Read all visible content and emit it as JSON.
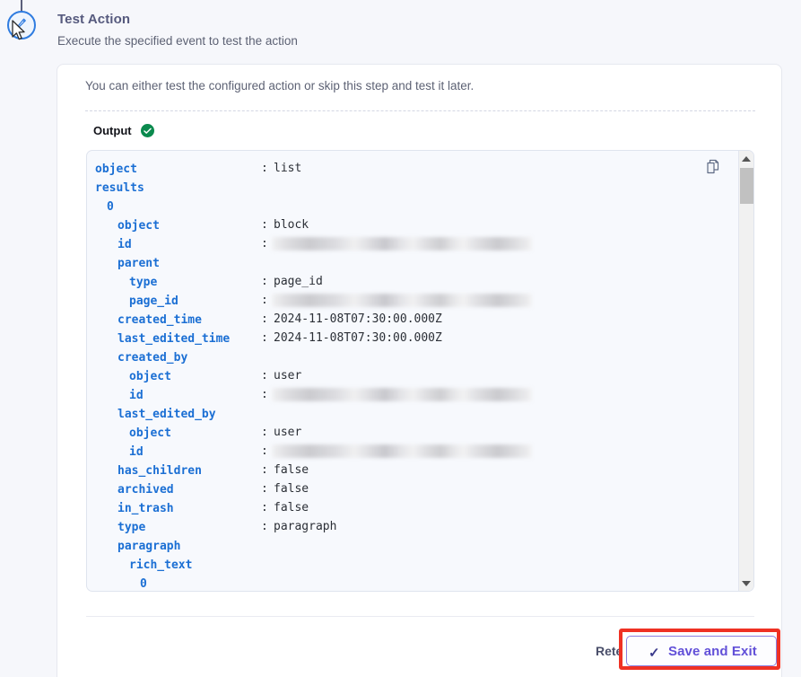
{
  "colors": {
    "accent_purple": "#6250d8",
    "highlight_red": "#ef3124",
    "success_green": "#0b8a4e",
    "json_key_blue": "#1b6fd4",
    "step_blue": "#2f7ce0"
  },
  "header": {
    "title": "Test Action",
    "subtitle": "Execute the specified event to test the action",
    "step_icon": "flask-icon",
    "cursor_icon": "mouse-pointer-icon"
  },
  "card": {
    "intro": "You can either test the configured action or skip this step and test it later.",
    "output_label": "Output",
    "output_status_icon": "check-circle-icon",
    "copy_icon": "copy-icon"
  },
  "scrollbar": {
    "up_icon": "triangle-up-icon",
    "down_icon": "triangle-down-icon"
  },
  "footer": {
    "retest_label": "Retest",
    "save_label": "Save and Exit",
    "save_icon": "check-icon"
  },
  "json_tree": [
    {
      "key": "object",
      "indent": 0,
      "value": "list",
      "redacted": false
    },
    {
      "key": "results",
      "indent": 0,
      "value": "",
      "redacted": false,
      "no_colon": true
    },
    {
      "key": "0",
      "indent": 1,
      "value": "",
      "redacted": false,
      "no_colon": true
    },
    {
      "key": "object",
      "indent": 2,
      "value": "block",
      "redacted": false
    },
    {
      "key": "id",
      "indent": 2,
      "value": "",
      "redacted": true
    },
    {
      "key": "parent",
      "indent": 2,
      "value": "",
      "redacted": false,
      "no_colon": true
    },
    {
      "key": "type",
      "indent": 3,
      "value": "page_id",
      "redacted": false
    },
    {
      "key": "page_id",
      "indent": 3,
      "value": "",
      "redacted": true
    },
    {
      "key": "created_time",
      "indent": 2,
      "value": "2024-11-08T07:30:00.000Z",
      "redacted": false
    },
    {
      "key": "last_edited_time",
      "indent": 2,
      "value": "2024-11-08T07:30:00.000Z",
      "redacted": false
    },
    {
      "key": "created_by",
      "indent": 2,
      "value": "",
      "redacted": false,
      "no_colon": true
    },
    {
      "key": "object",
      "indent": 3,
      "value": "user",
      "redacted": false
    },
    {
      "key": "id",
      "indent": 3,
      "value": "",
      "redacted": true
    },
    {
      "key": "last_edited_by",
      "indent": 2,
      "value": "",
      "redacted": false,
      "no_colon": true
    },
    {
      "key": "object",
      "indent": 3,
      "value": "user",
      "redacted": false
    },
    {
      "key": "id",
      "indent": 3,
      "value": "",
      "redacted": true
    },
    {
      "key": "has_children",
      "indent": 2,
      "value": "false",
      "redacted": false
    },
    {
      "key": "archived",
      "indent": 2,
      "value": "false",
      "redacted": false
    },
    {
      "key": "in_trash",
      "indent": 2,
      "value": "false",
      "redacted": false
    },
    {
      "key": "type",
      "indent": 2,
      "value": "paragraph",
      "redacted": false
    },
    {
      "key": "paragraph",
      "indent": 2,
      "value": "",
      "redacted": false,
      "no_colon": true
    },
    {
      "key": "rich_text",
      "indent": 3,
      "value": "",
      "redacted": false,
      "no_colon": true
    },
    {
      "key": "0",
      "indent": 4,
      "value": "",
      "redacted": false,
      "no_colon": true
    }
  ]
}
